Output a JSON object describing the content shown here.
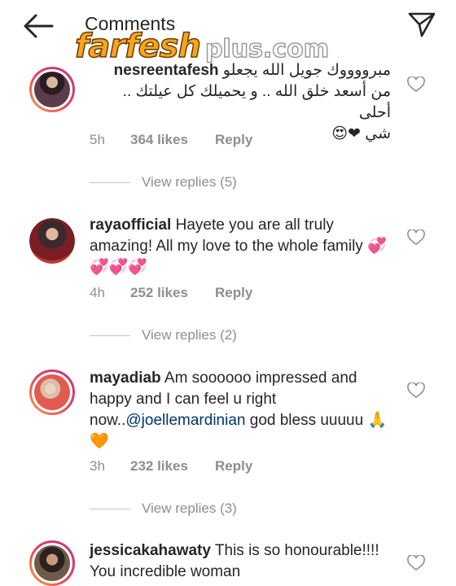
{
  "header": {
    "title": "Comments",
    "back_icon": "arrow-left-icon",
    "send_icon": "paper-plane-icon"
  },
  "watermark": {
    "main": "farfesh",
    "sub": "plus.com"
  },
  "comments": [
    {
      "username": "nesreentafesh",
      "text_line1": "مبرووووك جويل الله يجعلو",
      "text_line2": "من أسعد خلق الله .. و يحميلك كل عيلتك .. أحلى",
      "text_line3": "شي ❤😍",
      "time": "5h",
      "likes": "364 likes",
      "reply": "Reply",
      "view_replies": "View replies (5)"
    },
    {
      "username": "rayaofficial",
      "text": "Hayete you are all truly amazing! All my love to the whole family 💞💞💞💞",
      "time": "4h",
      "likes": "252 likes",
      "reply": "Reply",
      "view_replies": "View replies (2)"
    },
    {
      "username": "mayadiab",
      "text_before": "Am soooooo impressed and happy and I can feel u right now..",
      "mention": "@joellemardinian",
      "text_after": " god bless uuuuu 🙏🧡",
      "time": "3h",
      "likes": "232 likes",
      "reply": "Reply",
      "view_replies": "View replies (3)"
    },
    {
      "username": "jessicakahawaty",
      "text": "This is so honourable!!!! You incredible woman"
    }
  ],
  "colors": {
    "text": "#262626",
    "meta": "#8e8e8e",
    "mention": "#003569",
    "watermark_orange": "#f7a61a"
  }
}
